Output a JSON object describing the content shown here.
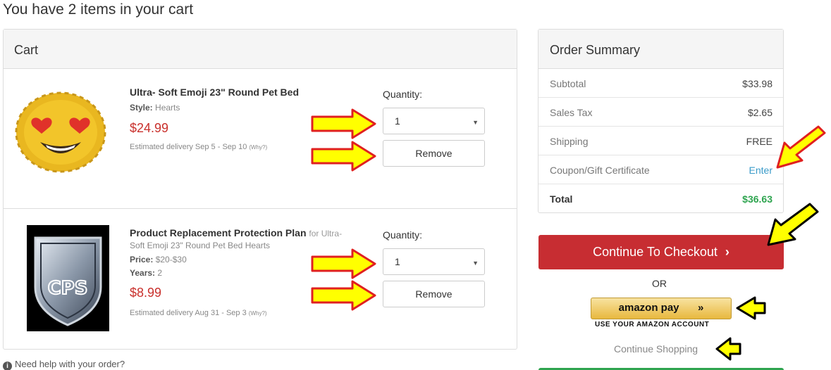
{
  "page": {
    "title": "You have 2 items in your cart"
  },
  "cart": {
    "header": "Cart",
    "items": [
      {
        "name": "Ultra- Soft Emoji 23\" Round Pet Bed",
        "style_label": "Style:",
        "style_value": "Hearts",
        "price": "$24.99",
        "delivery": "Estimated delivery Sep 5 - Sep 10",
        "why": "(Why?)",
        "quantity_label": "Quantity:",
        "quantity_value": "1",
        "remove_label": "Remove",
        "image_icon": "emoji-pet-bed-image"
      },
      {
        "name": "Product Replacement Protection Plan",
        "for_text": "for Ultra-",
        "for_text_cont": "Soft Emoji 23\" Round Pet Bed Hearts",
        "price_label": "Price:",
        "price_range": "$20-$30",
        "years_label": "Years:",
        "years_value": "2",
        "price": "$8.99",
        "delivery": "Estimated delivery Aug 31 - Sep 3",
        "why": "(Why?)",
        "quantity_label": "Quantity:",
        "quantity_value": "1",
        "remove_label": "Remove",
        "image_icon": "cps-shield-image",
        "image_text": "CPS"
      }
    ],
    "help_text": "Need help with your order?"
  },
  "summary": {
    "title": "Order Summary",
    "rows": [
      {
        "label": "Subtotal",
        "value": "$33.98"
      },
      {
        "label": "Sales Tax",
        "value": "$2.65"
      },
      {
        "label": "Shipping",
        "value": "FREE"
      },
      {
        "label": "Coupon/Gift Certificate",
        "value": "Enter"
      }
    ],
    "total_label": "Total",
    "total_value": "$36.63"
  },
  "checkout": {
    "button_label": "Continue To Checkout",
    "or_text": "OR",
    "amazon_label": "amazon pay",
    "amazon_chevron": "»",
    "amazon_sub": "USE YOUR AMAZON ACCOUNT",
    "continue_shopping": "Continue Shopping"
  },
  "colors": {
    "price_red": "#c9302c",
    "checkout_red": "#c72d32",
    "total_green": "#2ea44f",
    "link_blue": "#3a9bc9",
    "arrow_red": "#e02020",
    "arrow_yellow": "#ffff00"
  }
}
